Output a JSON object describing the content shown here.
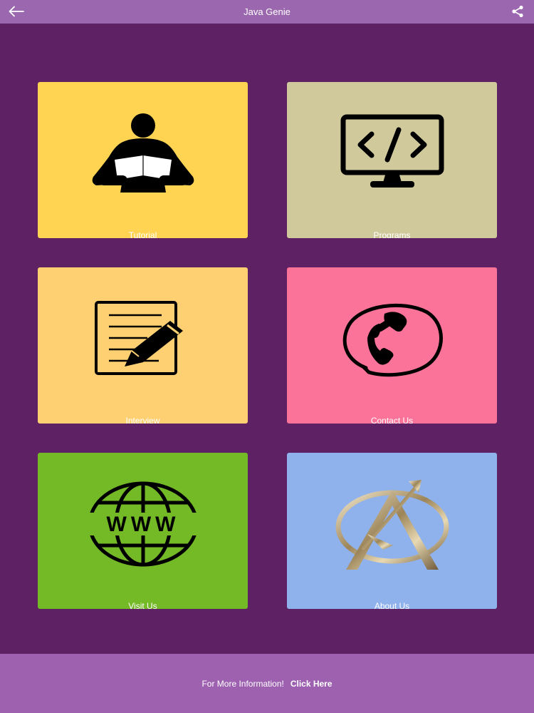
{
  "header": {
    "title": "Java Genie",
    "back_icon": "arrow-left-icon",
    "share_icon": "share-icon"
  },
  "tiles": [
    {
      "label": "Tutorial",
      "icon": "reader-icon",
      "color": "#fed452"
    },
    {
      "label": "Programs",
      "icon": "code-monitor-icon",
      "color": "#d0c99c"
    },
    {
      "label": "Interview",
      "icon": "notepad-pencil-icon",
      "color": "#fed072"
    },
    {
      "label": "Contact Us",
      "icon": "phone-icon",
      "color": "#fc7399"
    },
    {
      "label": "Visit Us",
      "icon": "globe-www-icon",
      "color": "#74b926"
    },
    {
      "label": "About Us",
      "icon": "compass-logo-icon",
      "color": "#8fb1ec"
    }
  ],
  "footer": {
    "text": "For More Information!",
    "link": "Click Here"
  },
  "colors": {
    "topbar": "#9b67ae",
    "background": "#5e2163",
    "footer": "#9e61b0"
  }
}
